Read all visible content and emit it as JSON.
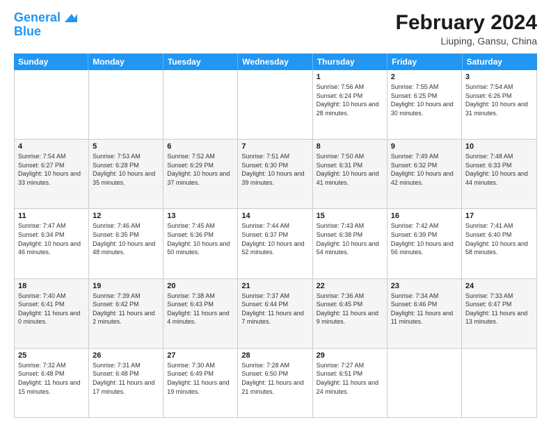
{
  "header": {
    "logo_line1": "General",
    "logo_line2": "Blue",
    "title": "February 2024",
    "subtitle": "Liuping, Gansu, China"
  },
  "calendar": {
    "days_of_week": [
      "Sunday",
      "Monday",
      "Tuesday",
      "Wednesday",
      "Thursday",
      "Friday",
      "Saturday"
    ],
    "rows": [
      [
        {
          "day": "",
          "sunrise": "",
          "sunset": "",
          "daylight": ""
        },
        {
          "day": "",
          "sunrise": "",
          "sunset": "",
          "daylight": ""
        },
        {
          "day": "",
          "sunrise": "",
          "sunset": "",
          "daylight": ""
        },
        {
          "day": "",
          "sunrise": "",
          "sunset": "",
          "daylight": ""
        },
        {
          "day": "1",
          "sunrise": "Sunrise: 7:56 AM",
          "sunset": "Sunset: 6:24 PM",
          "daylight": "Daylight: 10 hours and 28 minutes."
        },
        {
          "day": "2",
          "sunrise": "Sunrise: 7:55 AM",
          "sunset": "Sunset: 6:25 PM",
          "daylight": "Daylight: 10 hours and 30 minutes."
        },
        {
          "day": "3",
          "sunrise": "Sunrise: 7:54 AM",
          "sunset": "Sunset: 6:26 PM",
          "daylight": "Daylight: 10 hours and 31 minutes."
        }
      ],
      [
        {
          "day": "4",
          "sunrise": "Sunrise: 7:54 AM",
          "sunset": "Sunset: 6:27 PM",
          "daylight": "Daylight: 10 hours and 33 minutes."
        },
        {
          "day": "5",
          "sunrise": "Sunrise: 7:53 AM",
          "sunset": "Sunset: 6:28 PM",
          "daylight": "Daylight: 10 hours and 35 minutes."
        },
        {
          "day": "6",
          "sunrise": "Sunrise: 7:52 AM",
          "sunset": "Sunset: 6:29 PM",
          "daylight": "Daylight: 10 hours and 37 minutes."
        },
        {
          "day": "7",
          "sunrise": "Sunrise: 7:51 AM",
          "sunset": "Sunset: 6:30 PM",
          "daylight": "Daylight: 10 hours and 39 minutes."
        },
        {
          "day": "8",
          "sunrise": "Sunrise: 7:50 AM",
          "sunset": "Sunset: 6:31 PM",
          "daylight": "Daylight: 10 hours and 41 minutes."
        },
        {
          "day": "9",
          "sunrise": "Sunrise: 7:49 AM",
          "sunset": "Sunset: 6:32 PM",
          "daylight": "Daylight: 10 hours and 42 minutes."
        },
        {
          "day": "10",
          "sunrise": "Sunrise: 7:48 AM",
          "sunset": "Sunset: 6:33 PM",
          "daylight": "Daylight: 10 hours and 44 minutes."
        }
      ],
      [
        {
          "day": "11",
          "sunrise": "Sunrise: 7:47 AM",
          "sunset": "Sunset: 6:34 PM",
          "daylight": "Daylight: 10 hours and 46 minutes."
        },
        {
          "day": "12",
          "sunrise": "Sunrise: 7:46 AM",
          "sunset": "Sunset: 6:35 PM",
          "daylight": "Daylight: 10 hours and 48 minutes."
        },
        {
          "day": "13",
          "sunrise": "Sunrise: 7:45 AM",
          "sunset": "Sunset: 6:36 PM",
          "daylight": "Daylight: 10 hours and 50 minutes."
        },
        {
          "day": "14",
          "sunrise": "Sunrise: 7:44 AM",
          "sunset": "Sunset: 6:37 PM",
          "daylight": "Daylight: 10 hours and 52 minutes."
        },
        {
          "day": "15",
          "sunrise": "Sunrise: 7:43 AM",
          "sunset": "Sunset: 6:38 PM",
          "daylight": "Daylight: 10 hours and 54 minutes."
        },
        {
          "day": "16",
          "sunrise": "Sunrise: 7:42 AM",
          "sunset": "Sunset: 6:39 PM",
          "daylight": "Daylight: 10 hours and 56 minutes."
        },
        {
          "day": "17",
          "sunrise": "Sunrise: 7:41 AM",
          "sunset": "Sunset: 6:40 PM",
          "daylight": "Daylight: 10 hours and 58 minutes."
        }
      ],
      [
        {
          "day": "18",
          "sunrise": "Sunrise: 7:40 AM",
          "sunset": "Sunset: 6:41 PM",
          "daylight": "Daylight: 11 hours and 0 minutes."
        },
        {
          "day": "19",
          "sunrise": "Sunrise: 7:39 AM",
          "sunset": "Sunset: 6:42 PM",
          "daylight": "Daylight: 11 hours and 2 minutes."
        },
        {
          "day": "20",
          "sunrise": "Sunrise: 7:38 AM",
          "sunset": "Sunset: 6:43 PM",
          "daylight": "Daylight: 11 hours and 4 minutes."
        },
        {
          "day": "21",
          "sunrise": "Sunrise: 7:37 AM",
          "sunset": "Sunset: 6:44 PM",
          "daylight": "Daylight: 11 hours and 7 minutes."
        },
        {
          "day": "22",
          "sunrise": "Sunrise: 7:36 AM",
          "sunset": "Sunset: 6:45 PM",
          "daylight": "Daylight: 11 hours and 9 minutes."
        },
        {
          "day": "23",
          "sunrise": "Sunrise: 7:34 AM",
          "sunset": "Sunset: 6:46 PM",
          "daylight": "Daylight: 11 hours and 11 minutes."
        },
        {
          "day": "24",
          "sunrise": "Sunrise: 7:33 AM",
          "sunset": "Sunset: 6:47 PM",
          "daylight": "Daylight: 11 hours and 13 minutes."
        }
      ],
      [
        {
          "day": "25",
          "sunrise": "Sunrise: 7:32 AM",
          "sunset": "Sunset: 6:48 PM",
          "daylight": "Daylight: 11 hours and 15 minutes."
        },
        {
          "day": "26",
          "sunrise": "Sunrise: 7:31 AM",
          "sunset": "Sunset: 6:48 PM",
          "daylight": "Daylight: 11 hours and 17 minutes."
        },
        {
          "day": "27",
          "sunrise": "Sunrise: 7:30 AM",
          "sunset": "Sunset: 6:49 PM",
          "daylight": "Daylight: 11 hours and 19 minutes."
        },
        {
          "day": "28",
          "sunrise": "Sunrise: 7:28 AM",
          "sunset": "Sunset: 6:50 PM",
          "daylight": "Daylight: 11 hours and 21 minutes."
        },
        {
          "day": "29",
          "sunrise": "Sunrise: 7:27 AM",
          "sunset": "Sunset: 6:51 PM",
          "daylight": "Daylight: 11 hours and 24 minutes."
        },
        {
          "day": "",
          "sunrise": "",
          "sunset": "",
          "daylight": ""
        },
        {
          "day": "",
          "sunrise": "",
          "sunset": "",
          "daylight": ""
        }
      ]
    ]
  }
}
